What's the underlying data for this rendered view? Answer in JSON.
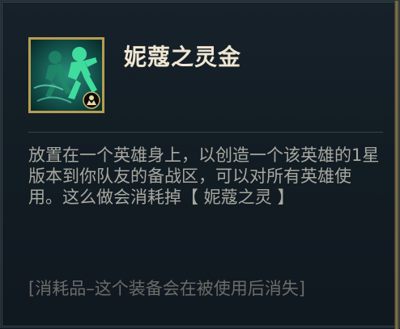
{
  "item": {
    "name": "妮蔻之灵金",
    "icon": "running-clone-icon",
    "badge_icon": "tactician-badge-icon",
    "description": "放置在一个英雄身上，以创造一个该英雄的1星版本到你队友的备战区，可以对所有英雄使用。这么做会消耗掉【 妮蔻之灵 】",
    "consumable_note": "[消耗品–这个装备会在被使用后消失]"
  },
  "colors": {
    "title": "#f0e6d2",
    "body_text": "#a8a8a0",
    "note_text": "#6c6c68",
    "frame_gold": "#b79c52",
    "icon_green": "#3fdc9e"
  }
}
